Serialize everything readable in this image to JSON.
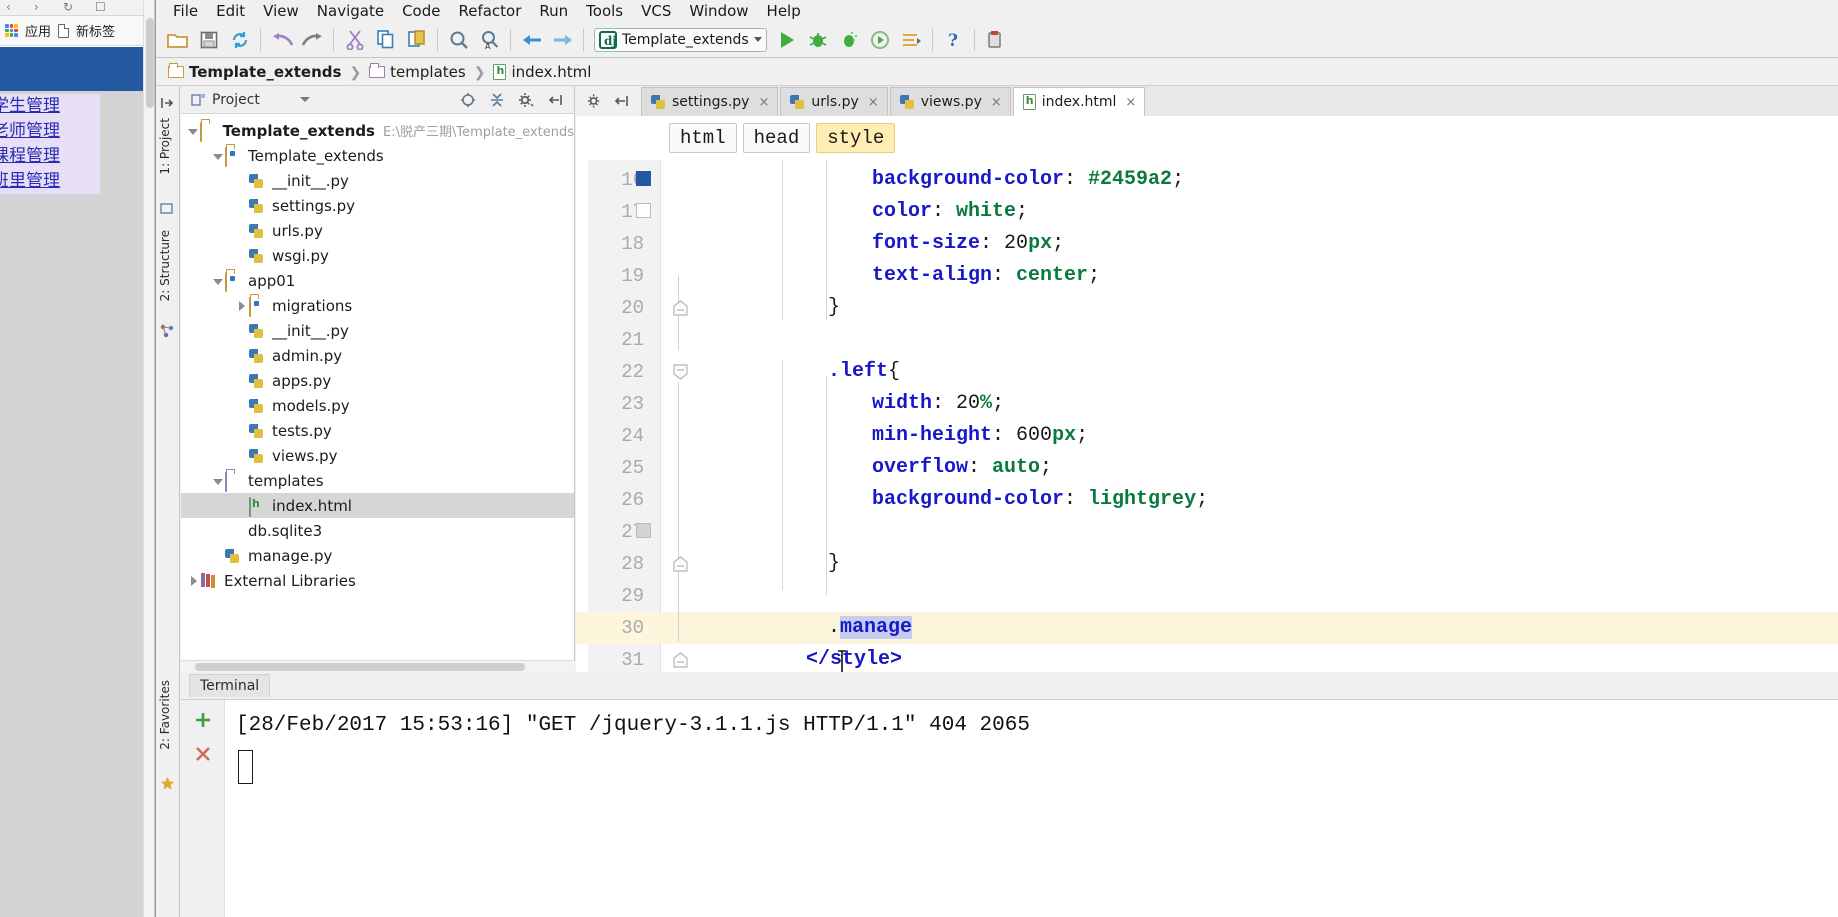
{
  "browser": {
    "nav_buttons": [
      "‹",
      "›",
      "↻",
      "☐"
    ],
    "bookmarks": [
      {
        "icon": "apps-grid-icon",
        "label": "应用"
      },
      {
        "icon": "page-icon",
        "label": "新标签"
      }
    ],
    "page_links": [
      "学生管理",
      "老师管理",
      "课程管理",
      "班里管理"
    ],
    "header_color": "#2459a2",
    "body_color": "#d3d3d3"
  },
  "ide": {
    "menubar": [
      "File",
      "Edit",
      "View",
      "Navigate",
      "Code",
      "Refactor",
      "Run",
      "Tools",
      "VCS",
      "Window",
      "Help"
    ],
    "toolbar_icons": [
      "open-folder-icon",
      "save-icon",
      "sync-icon",
      "undo-icon",
      "redo-icon",
      "cut-icon",
      "copy-icon",
      "paste-icon",
      "find-icon",
      "replace-icon",
      "back-icon",
      "forward-icon"
    ],
    "run_config": {
      "name": "Template_extends",
      "icon": "django-icon"
    },
    "run_icons": [
      "run-icon",
      "debug-icon",
      "coverage-icon",
      "profile-icon",
      "update-icon",
      "help-icon",
      "settings-icon"
    ],
    "breadcrumb": [
      {
        "icon": "folder-icon",
        "label": "Template_extends",
        "bold": true
      },
      {
        "icon": "folder-icon",
        "label": "templates",
        "bold": false
      },
      {
        "icon": "html-file-icon",
        "label": "index.html",
        "bold": false
      }
    ],
    "tool_strip_left": [
      "1: Project",
      "2: Structure"
    ],
    "tool_strip_bottom": [
      "2: Favorites"
    ]
  },
  "project_panel": {
    "title": "Project",
    "action_icons": [
      "collapse-all-icon",
      "expand-icon",
      "settings-gear-icon",
      "hide-icon"
    ],
    "tree": [
      {
        "indent": 0,
        "arrow": "down",
        "icon": "folder-icon",
        "label": "Template_extends",
        "bold": true,
        "path": "E:\\脱产三期\\Template_extends",
        "selected": false
      },
      {
        "indent": 1,
        "arrow": "down",
        "icon": "source-folder-icon",
        "label": "Template_extends",
        "bold": false,
        "path": "",
        "selected": false
      },
      {
        "indent": 2,
        "arrow": "none",
        "icon": "python-file-icon",
        "label": "__init__.py",
        "bold": false,
        "path": "",
        "selected": false
      },
      {
        "indent": 2,
        "arrow": "none",
        "icon": "python-file-icon",
        "label": "settings.py",
        "bold": false,
        "path": "",
        "selected": false
      },
      {
        "indent": 2,
        "arrow": "none",
        "icon": "python-file-icon",
        "label": "urls.py",
        "bold": false,
        "path": "",
        "selected": false
      },
      {
        "indent": 2,
        "arrow": "none",
        "icon": "python-file-icon",
        "label": "wsgi.py",
        "bold": false,
        "path": "",
        "selected": false
      },
      {
        "indent": 1,
        "arrow": "down",
        "icon": "source-folder-icon",
        "label": "app01",
        "bold": false,
        "path": "",
        "selected": false
      },
      {
        "indent": 2,
        "arrow": "right",
        "icon": "source-folder-icon",
        "label": "migrations",
        "bold": false,
        "path": "",
        "selected": false
      },
      {
        "indent": 2,
        "arrow": "none",
        "icon": "python-file-icon",
        "label": "__init__.py",
        "bold": false,
        "path": "",
        "selected": false
      },
      {
        "indent": 2,
        "arrow": "none",
        "icon": "python-file-icon",
        "label": "admin.py",
        "bold": false,
        "path": "",
        "selected": false
      },
      {
        "indent": 2,
        "arrow": "none",
        "icon": "python-file-icon",
        "label": "apps.py",
        "bold": false,
        "path": "",
        "selected": false
      },
      {
        "indent": 2,
        "arrow": "none",
        "icon": "python-file-icon",
        "label": "models.py",
        "bold": false,
        "path": "",
        "selected": false
      },
      {
        "indent": 2,
        "arrow": "none",
        "icon": "python-file-icon",
        "label": "tests.py",
        "bold": false,
        "path": "",
        "selected": false
      },
      {
        "indent": 2,
        "arrow": "none",
        "icon": "python-file-icon",
        "label": "views.py",
        "bold": false,
        "path": "",
        "selected": false
      },
      {
        "indent": 1,
        "arrow": "down",
        "icon": "templates-folder-icon",
        "label": "templates",
        "bold": false,
        "path": "",
        "selected": false
      },
      {
        "indent": 2,
        "arrow": "none",
        "icon": "html-file-icon",
        "label": "index.html",
        "bold": false,
        "path": "",
        "selected": true
      },
      {
        "indent": 1,
        "arrow": "none",
        "icon": "database-icon",
        "label": "db.sqlite3",
        "bold": false,
        "path": "",
        "selected": false
      },
      {
        "indent": 1,
        "arrow": "none",
        "icon": "python-file-icon",
        "label": "manage.py",
        "bold": false,
        "path": "",
        "selected": false
      },
      {
        "indent": 0,
        "arrow": "right",
        "icon": "libraries-icon",
        "label": "External Libraries",
        "bold": false,
        "path": "",
        "selected": false
      }
    ]
  },
  "editor": {
    "tabs": [
      {
        "label": "settings.py",
        "icon": "python-file-icon",
        "active": false
      },
      {
        "label": "urls.py",
        "icon": "python-file-icon",
        "active": false
      },
      {
        "label": "views.py",
        "icon": "python-file-icon",
        "active": false
      },
      {
        "label": "index.html",
        "icon": "html-file-icon",
        "active": true
      }
    ],
    "tab_close_label": "×",
    "tool_icons": [
      "settings-gear-icon",
      "hide-panel-icon"
    ],
    "structure_path": [
      {
        "label": "html",
        "highlighted": false
      },
      {
        "label": "head",
        "highlighted": false
      },
      {
        "label": "style",
        "highlighted": true
      }
    ],
    "lines": [
      {
        "num": "16",
        "indent": 4,
        "tokens": [
          {
            "t": "background-color",
            "c": "prop"
          },
          {
            "t": ": ",
            "c": "punc"
          },
          {
            "t": "#2459a2",
            "c": "val"
          },
          {
            "t": ";",
            "c": "punc"
          }
        ]
      },
      {
        "num": "17",
        "indent": 4,
        "tokens": [
          {
            "t": "color",
            "c": "prop"
          },
          {
            "t": ": ",
            "c": "punc"
          },
          {
            "t": "white",
            "c": "val"
          },
          {
            "t": ";",
            "c": "punc"
          }
        ]
      },
      {
        "num": "18",
        "indent": 4,
        "tokens": [
          {
            "t": "font-size",
            "c": "prop"
          },
          {
            "t": ": ",
            "c": "punc"
          },
          {
            "t": "20",
            "c": "num"
          },
          {
            "t": "px",
            "c": "val"
          },
          {
            "t": ";",
            "c": "punc"
          }
        ]
      },
      {
        "num": "19",
        "indent": 4,
        "tokens": [
          {
            "t": "text-align",
            "c": "prop"
          },
          {
            "t": ": ",
            "c": "punc"
          },
          {
            "t": "center",
            "c": "val"
          },
          {
            "t": ";",
            "c": "punc"
          }
        ]
      },
      {
        "num": "20",
        "indent": 2,
        "tokens": [
          {
            "t": "}",
            "c": "punc"
          }
        ]
      },
      {
        "num": "21",
        "indent": 0,
        "tokens": []
      },
      {
        "num": "22",
        "indent": 2,
        "tokens": [
          {
            "t": ".left",
            "c": "prop"
          },
          {
            "t": "{",
            "c": "punc"
          }
        ]
      },
      {
        "num": "23",
        "indent": 4,
        "tokens": [
          {
            "t": "width",
            "c": "prop"
          },
          {
            "t": ": ",
            "c": "punc"
          },
          {
            "t": "20",
            "c": "num"
          },
          {
            "t": "%",
            "c": "val"
          },
          {
            "t": ";",
            "c": "punc"
          }
        ]
      },
      {
        "num": "24",
        "indent": 4,
        "tokens": [
          {
            "t": "min-height",
            "c": "prop"
          },
          {
            "t": ": ",
            "c": "punc"
          },
          {
            "t": "600",
            "c": "num"
          },
          {
            "t": "px",
            "c": "val"
          },
          {
            "t": ";",
            "c": "punc"
          }
        ]
      },
      {
        "num": "25",
        "indent": 4,
        "tokens": [
          {
            "t": "overflow",
            "c": "prop"
          },
          {
            "t": ": ",
            "c": "punc"
          },
          {
            "t": "auto",
            "c": "val"
          },
          {
            "t": ";",
            "c": "punc"
          }
        ]
      },
      {
        "num": "26",
        "indent": 4,
        "tokens": [
          {
            "t": "background-color",
            "c": "prop"
          },
          {
            "t": ": ",
            "c": "punc"
          },
          {
            "t": "lightgrey",
            "c": "val"
          },
          {
            "t": ";",
            "c": "punc"
          }
        ]
      },
      {
        "num": "27",
        "indent": 0,
        "tokens": []
      },
      {
        "num": "28",
        "indent": 2,
        "tokens": [
          {
            "t": "}",
            "c": "punc"
          }
        ]
      },
      {
        "num": "29",
        "indent": 0,
        "tokens": []
      },
      {
        "num": "30",
        "indent": 2,
        "tokens": [
          {
            "t": ".",
            "c": "punc"
          },
          {
            "t": "manage",
            "c": "prop",
            "sel": true
          }
        ]
      },
      {
        "num": "31",
        "indent": 1,
        "tokens": [
          {
            "t": "</style>",
            "c": "tag"
          }
        ]
      }
    ],
    "current_line": "30",
    "selected_text": "manage",
    "cursor_line_number": "30"
  },
  "terminal": {
    "tab_label": "Terminal",
    "side_icons": [
      "add-icon",
      "close-icon"
    ],
    "output": "[28/Feb/2017 15:53:16] ″GET /jquery-3.1.1.js HTTP/1.1″ 404 2065"
  },
  "colors": {
    "accent_blue": "#2459a2",
    "selection": "#c5cdf0",
    "line_highlight": "#fdf6dd",
    "keyword_blue": "#1818c8",
    "value_green": "#0a7a3f"
  }
}
